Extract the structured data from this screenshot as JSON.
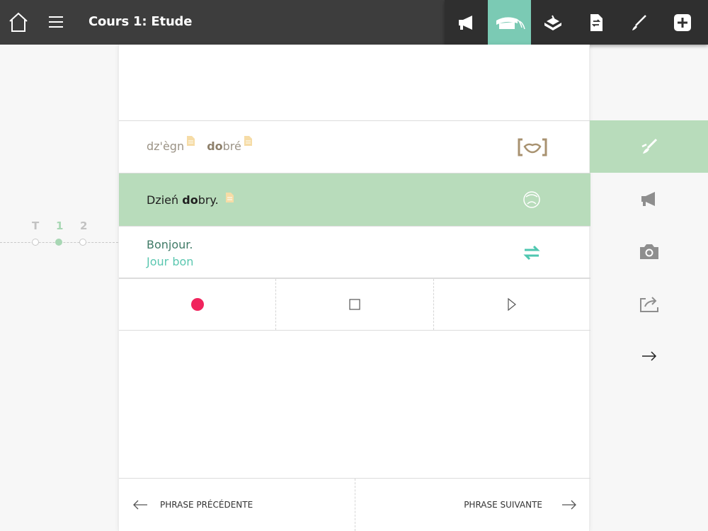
{
  "header": {
    "title": "Cours 1: Etude",
    "tools": [
      "speaker-icon",
      "graduation-cap-icon",
      "book-stand-icon",
      "translate-doc-icon",
      "brush-icon",
      "plus-icon"
    ]
  },
  "phonetic": {
    "word1": "dz'ègn",
    "word2_bold": "do",
    "word2_rest": "bré"
  },
  "original": {
    "word1": "Dzień ",
    "word2_bold": "do",
    "word2_rest": "bry."
  },
  "translation": {
    "line1": "Bonjour.",
    "line2": "Jour bon"
  },
  "colors": {
    "accent": "#7bcab4",
    "row_highlight": "#b8dcbb",
    "record": "#f0245d",
    "note": "#f6dca6"
  },
  "footer": {
    "prev": "PHRASE PRÉCÉDENTE",
    "next": "PHRASE SUIVANTE"
  },
  "timeline": {
    "labels": [
      "T",
      "1",
      "2"
    ],
    "active": "1"
  }
}
